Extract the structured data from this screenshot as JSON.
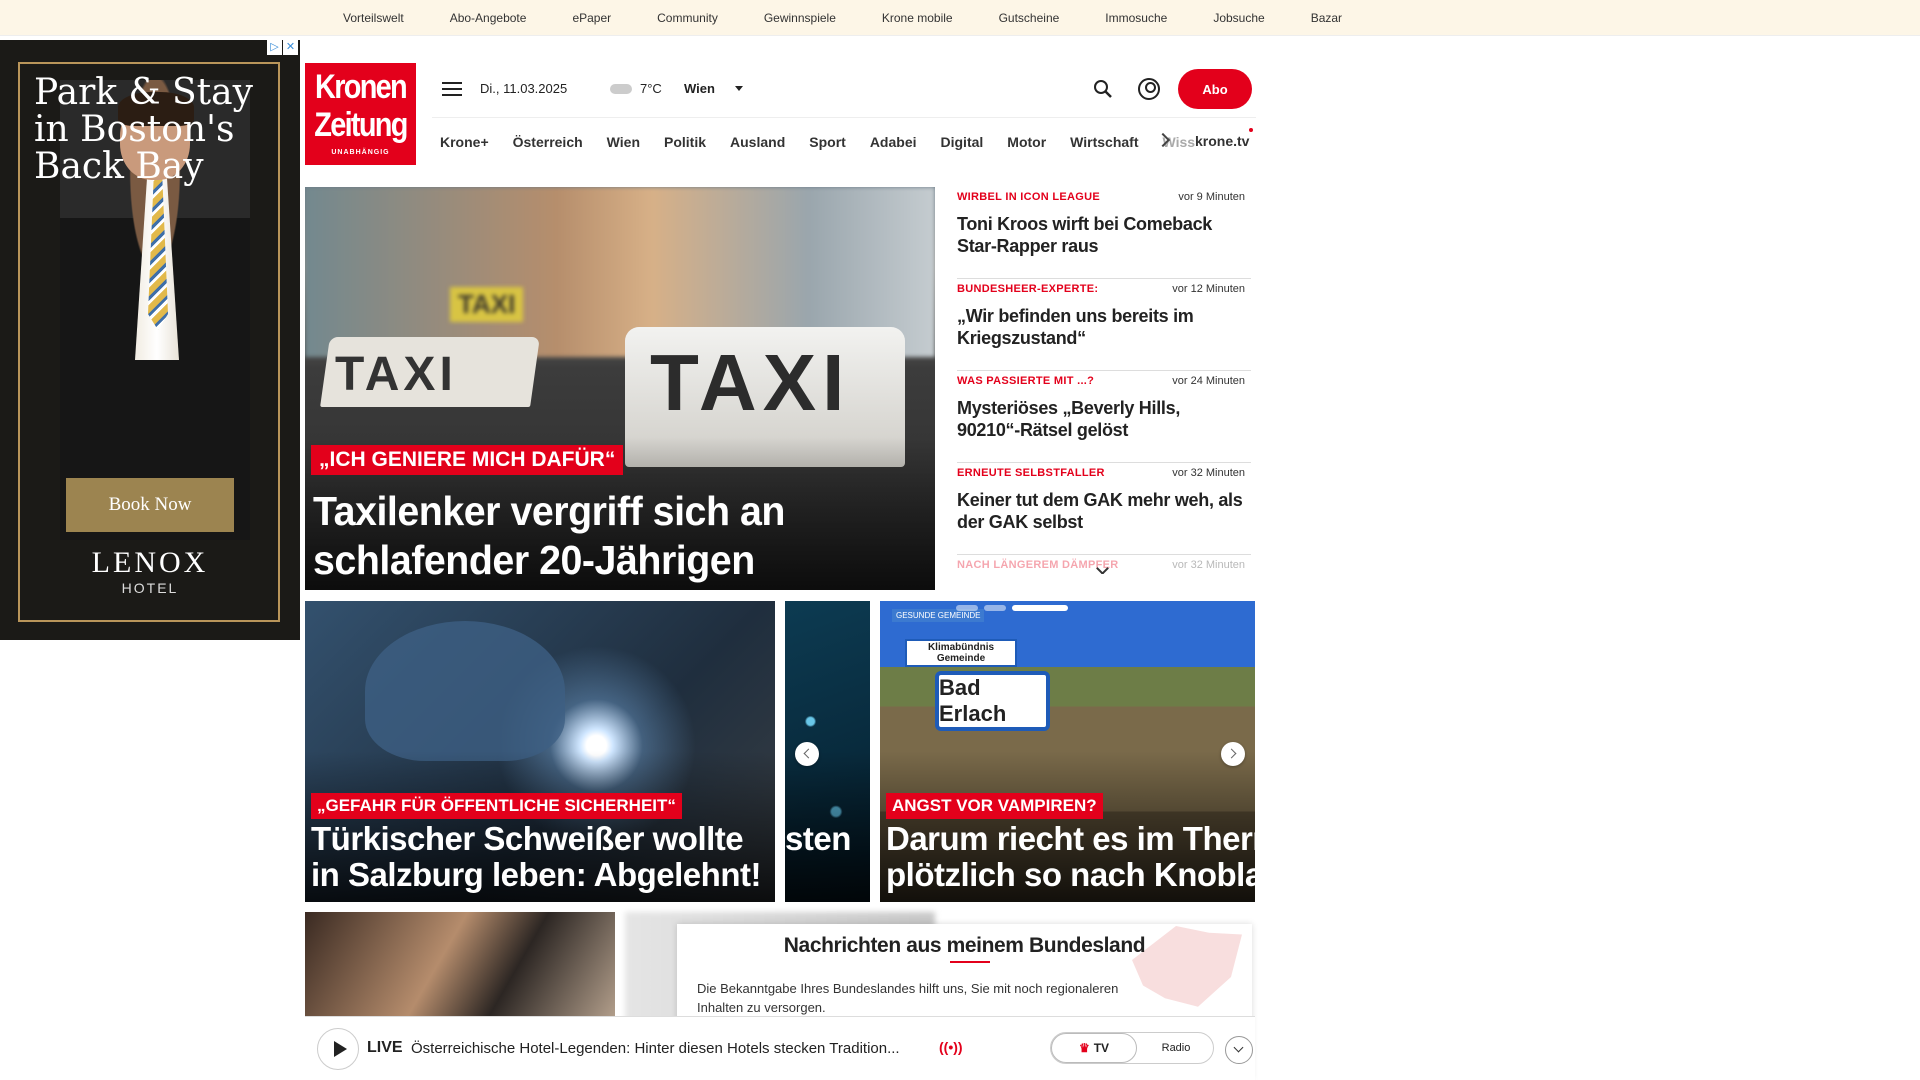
{
  "topbar": {
    "links": [
      "Vorteilswelt",
      "Abo-Angebote",
      "ePaper",
      "Community",
      "Gewinnspiele",
      "Krone mobile",
      "Gutscheine",
      "Immosuche",
      "Jobsuche",
      "Bazar"
    ]
  },
  "ad": {
    "title": "Park & Stay in Boston's Back Bay",
    "button": "Book Now",
    "brand": "LENOX",
    "sub": "HOTEL",
    "badge_info": "▷",
    "badge_close": "✕"
  },
  "logo": {
    "line1": "Kronen",
    "line2": "Zeitung",
    "line3": "UNABHÄNGIG"
  },
  "header": {
    "date": "Di., 11.03.2025",
    "temp": "7°C",
    "city": "Wien",
    "abo": "Abo"
  },
  "nav": {
    "items": [
      "Krone+",
      "Österreich",
      "Wien",
      "Politik",
      "Ausland",
      "Sport",
      "Adabei",
      "Digital",
      "Motor",
      "Wirtschaft",
      "Wiss"
    ],
    "tv": "krone.tv"
  },
  "hero": {
    "kicker": "„ICH GENIERE MICH DAFÜR“",
    "headline": "Taxilenker vergriff sich an schlafender 20-Jährigen",
    "sign_small": "TAXI",
    "sign_large": "TAXI",
    "sign_back": "TAXI"
  },
  "news": [
    {
      "cat": "WIRBEL IN ICON LEAGUE",
      "time": "vor 9 Minuten",
      "title": "Toni Kroos wirft bei Comeback Star-Rapper raus"
    },
    {
      "cat": "BUNDESHEER-EXPERTE:",
      "time": "vor 12 Minuten",
      "title": "„Wir befinden uns bereits im Kriegszustand“"
    },
    {
      "cat": "WAS PASSIERTE MIT ...?",
      "time": "vor 24 Minuten",
      "title": "Mysteriöses „Beverly Hills, 90210“-Rätsel gelöst"
    },
    {
      "cat": "ERNEUTE SELBSTFALLER",
      "time": "vor 32 Minuten",
      "title": "Keiner tut dem GAK mehr weh, als der GAK selbst"
    },
    {
      "cat": "NACH LÄNGEREM DÄMPFER",
      "time": "vor 32 Minuten",
      "title": ""
    }
  ],
  "cards": [
    {
      "kicker": "„GEFAHR FÜR ÖFFENTLICHE SICHERHEIT“",
      "headline1": "Türkischer Schweißer wollte",
      "headline2": "in Salzburg leben: Abgelehnt!"
    },
    {
      "kicker": "",
      "headline1": "",
      "headline2": "sten"
    },
    {
      "kicker": "ANGST VOR VAMPIREN?",
      "headline1": "Darum riecht es im Therm",
      "headline2": "plötzlich so nach Knoblau",
      "sign": "Bad Erlach",
      "sign_top": "Klimabündnis Gemeinde",
      "badge": "GESUNDE GEMEINDE"
    }
  ],
  "popup": {
    "title": "Nachrichten aus meinem Bundesland",
    "text": "Die Bekanntgabe Ihres Bundeslandes hilft uns, Sie mit noch regionaleren Inhalten zu versorgen."
  },
  "player": {
    "live": "LIVE",
    "title": "Österreichische Hotel-Legenden: Hinter diesen Hotels stecken Tradition...",
    "radio_icon": "((•))",
    "tv": "TV",
    "radio": "Radio"
  }
}
